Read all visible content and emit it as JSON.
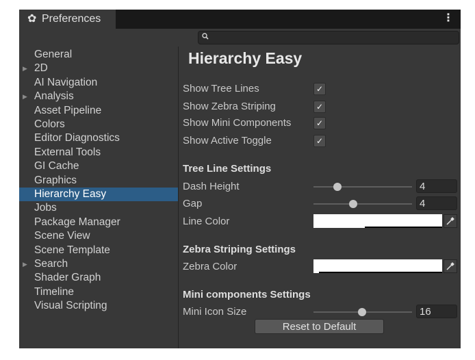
{
  "window": {
    "tab_title": "Preferences",
    "tab_icon": "gear-icon",
    "menu_icon": "kebab-menu-icon"
  },
  "search": {
    "placeholder": "",
    "value": ""
  },
  "sidebar": {
    "items": [
      {
        "label": "General",
        "expandable": false,
        "active": false
      },
      {
        "label": "2D",
        "expandable": true,
        "active": false
      },
      {
        "label": "AI Navigation",
        "expandable": false,
        "active": false
      },
      {
        "label": "Analysis",
        "expandable": true,
        "active": false
      },
      {
        "label": "Asset Pipeline",
        "expandable": false,
        "active": false
      },
      {
        "label": "Colors",
        "expandable": false,
        "active": false
      },
      {
        "label": "Editor Diagnostics",
        "expandable": false,
        "active": false
      },
      {
        "label": "External Tools",
        "expandable": false,
        "active": false
      },
      {
        "label": "GI Cache",
        "expandable": false,
        "active": false
      },
      {
        "label": "Graphics",
        "expandable": false,
        "active": false
      },
      {
        "label": "Hierarchy Easy",
        "expandable": false,
        "active": true
      },
      {
        "label": "Jobs",
        "expandable": false,
        "active": false
      },
      {
        "label": "Package Manager",
        "expandable": false,
        "active": false
      },
      {
        "label": "Scene View",
        "expandable": false,
        "active": false
      },
      {
        "label": "Scene Template",
        "expandable": false,
        "active": false
      },
      {
        "label": "Search",
        "expandable": true,
        "active": false
      },
      {
        "label": "Shader Graph",
        "expandable": false,
        "active": false
      },
      {
        "label": "Timeline",
        "expandable": false,
        "active": false
      },
      {
        "label": "Visual Scripting",
        "expandable": false,
        "active": false
      }
    ]
  },
  "main": {
    "title": "Hierarchy Easy",
    "toggles": [
      {
        "label": "Show Tree Lines",
        "checked": true
      },
      {
        "label": "Show Zebra Striping",
        "checked": true
      },
      {
        "label": "Show Mini Components",
        "checked": true
      },
      {
        "label": "Show Active Toggle",
        "checked": true
      }
    ],
    "tree_line_settings": {
      "header": "Tree Line Settings",
      "dash_height": {
        "label": "Dash Height",
        "value": "4",
        "slider_fraction": 0.24
      },
      "gap": {
        "label": "Gap",
        "value": "4",
        "slider_fraction": 0.4
      },
      "line_color": {
        "label": "Line Color",
        "color": "#ffffff",
        "alpha_fraction": 0.4
      }
    },
    "zebra_settings": {
      "header": "Zebra Striping Settings",
      "zebra_color": {
        "label": "Zebra Color",
        "color": "#ffffff",
        "alpha_fraction": 0.04
      }
    },
    "mini_settings": {
      "header": "Mini components Settings",
      "mini_icon_size": {
        "label": "Mini Icon Size",
        "value": "16",
        "slider_fraction": 0.49
      }
    },
    "reset_label": "Reset to Default"
  },
  "colors": {
    "window_bg": "#383838",
    "titlebar_bg": "#191919",
    "selection": "#2c5d87"
  }
}
